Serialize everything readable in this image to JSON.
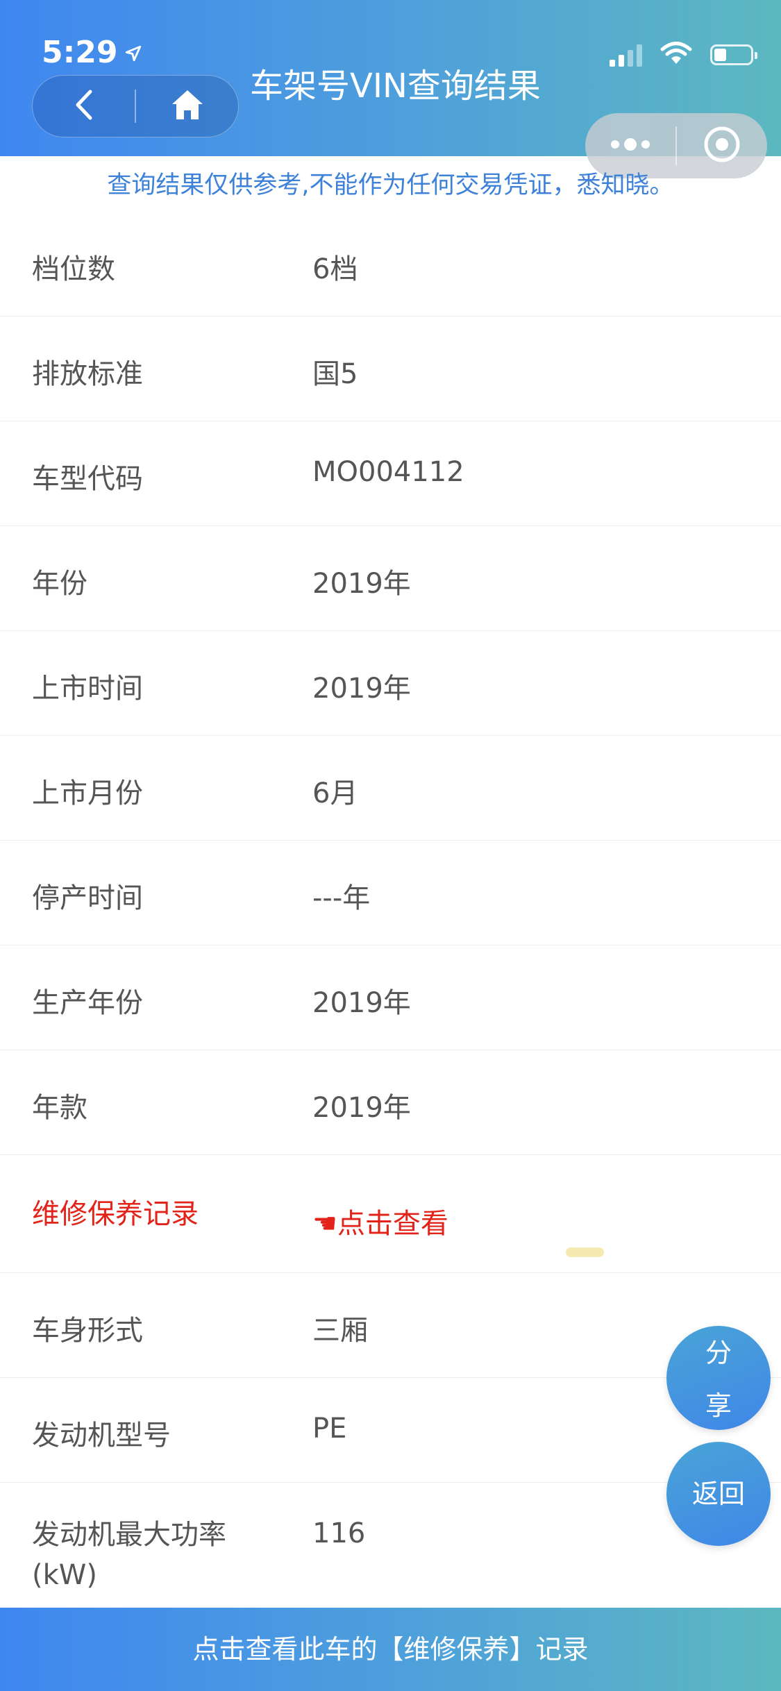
{
  "status_bar": {
    "time": "5:29"
  },
  "header": {
    "title": "车架号VIN查询结果"
  },
  "notice": "查询结果仅供参考,不能作为任何交易凭证，悉知晓。",
  "rows": [
    {
      "label": "档位数",
      "value": "6档"
    },
    {
      "label": "排放标准",
      "value": "国5"
    },
    {
      "label": "车型代码",
      "value": "MO004112"
    },
    {
      "label": "年份",
      "value": "2019年"
    },
    {
      "label": "上市时间",
      "value": "2019年"
    },
    {
      "label": "上市月份",
      "value": "6月"
    },
    {
      "label": "停产时间",
      "value": "---年"
    },
    {
      "label": "生产年份",
      "value": "2019年"
    },
    {
      "label": "年款",
      "value": "2019年"
    },
    {
      "label": "维修保养记录",
      "value": "☚点击查看"
    },
    {
      "label": "车身形式",
      "value": "三厢"
    },
    {
      "label": "发动机型号",
      "value": "PE"
    },
    {
      "label": "发动机最大功率(kW)",
      "value": "116"
    }
  ],
  "fab": {
    "share_1": "分",
    "share_2": "享",
    "back": "返回"
  },
  "bottom_bar": {
    "label": "点击查看此车的【维修保养】记录"
  },
  "colors": {
    "accent": "#3f87f0",
    "link_red": "#e2231a",
    "notice_blue": "#3d82d8"
  }
}
